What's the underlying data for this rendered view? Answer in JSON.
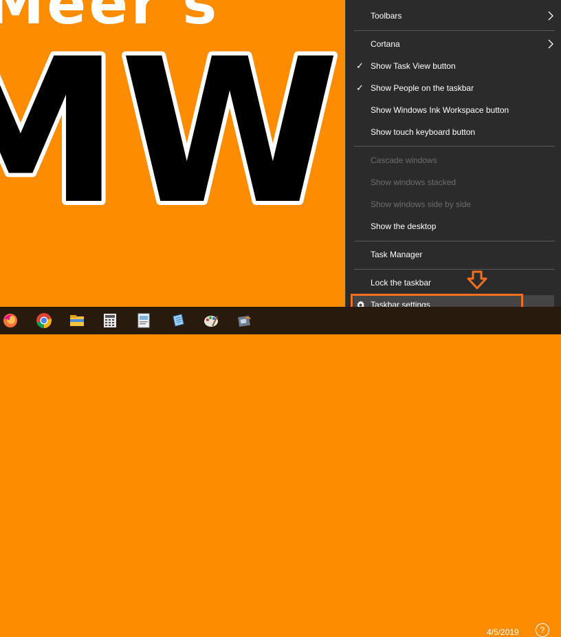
{
  "wallpaper": {
    "background_color": "#fd8c00",
    "top_text": "Meer's",
    "big_text": "MW"
  },
  "context_menu": {
    "items": [
      {
        "label": "Toolbars",
        "has_submenu": true,
        "checked": false,
        "disabled": false
      },
      {
        "label": "Cortana",
        "has_submenu": true,
        "checked": false,
        "disabled": false
      },
      {
        "label": "Show Task View button",
        "has_submenu": false,
        "checked": true,
        "disabled": false
      },
      {
        "label": "Show People on the taskbar",
        "has_submenu": false,
        "checked": true,
        "disabled": false
      },
      {
        "label": "Show Windows Ink Workspace button",
        "has_submenu": false,
        "checked": false,
        "disabled": false
      },
      {
        "label": "Show touch keyboard button",
        "has_submenu": false,
        "checked": false,
        "disabled": false
      },
      {
        "label": "Cascade windows",
        "has_submenu": false,
        "checked": false,
        "disabled": true
      },
      {
        "label": "Show windows stacked",
        "has_submenu": false,
        "checked": false,
        "disabled": true
      },
      {
        "label": "Show windows side by side",
        "has_submenu": false,
        "checked": false,
        "disabled": true
      },
      {
        "label": "Show the desktop",
        "has_submenu": false,
        "checked": false,
        "disabled": false
      },
      {
        "label": "Task Manager",
        "has_submenu": false,
        "checked": false,
        "disabled": false
      },
      {
        "label": "Lock the taskbar",
        "has_submenu": false,
        "checked": false,
        "disabled": false
      },
      {
        "label": "Taskbar settings",
        "has_submenu": false,
        "checked": false,
        "disabled": false,
        "icon": "gear-icon",
        "hovered": true
      }
    ],
    "check_glyph": "✓",
    "highlight_color": "#f36f22"
  },
  "taskbar": {
    "background_color": "#281a0c",
    "apps": [
      {
        "name": "firefox-icon"
      },
      {
        "name": "chrome-icon"
      },
      {
        "name": "file-explorer-icon"
      },
      {
        "name": "calculator-icon"
      },
      {
        "name": "document-viewer-icon"
      },
      {
        "name": "notepad-icon"
      },
      {
        "name": "paint-icon"
      },
      {
        "name": "movie-maker-icon"
      }
    ],
    "clock_date": "4/5/2019",
    "notification_glyph": "?"
  }
}
